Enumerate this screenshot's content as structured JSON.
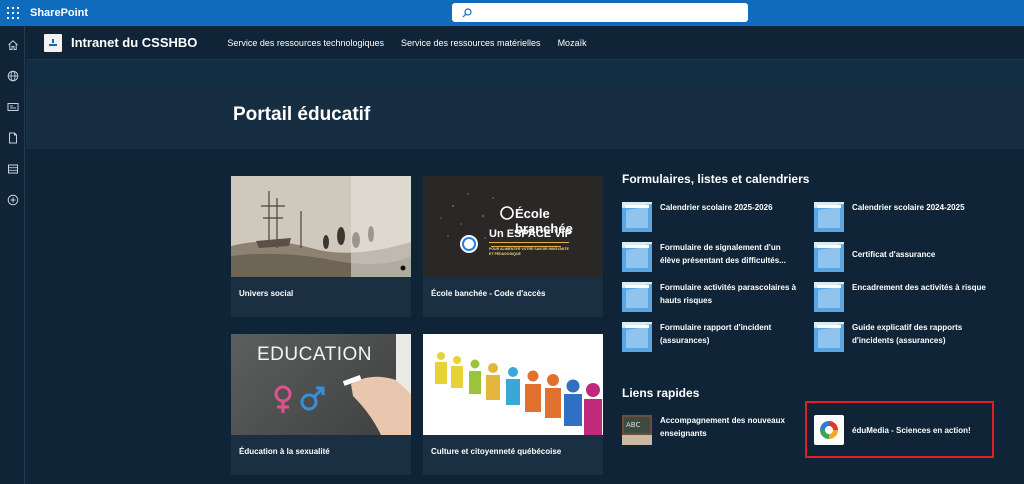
{
  "suitebar": {
    "app_name": "SharePoint",
    "search_placeholder": ""
  },
  "site": {
    "title": "Intranet du CSSHBO",
    "nav": [
      "Service des ressources technologiques",
      "Service des ressources matérielles",
      "Mozaïk"
    ]
  },
  "page": {
    "title": "Portail éducatif"
  },
  "tiles": [
    {
      "label": "Univers social",
      "thumb": "historical-painting"
    },
    {
      "label": "École banchée - Code d'accès",
      "thumb": "ecole-branchee"
    },
    {
      "label": "Éducation à la sexualité",
      "thumb": "education-chalkboard"
    },
    {
      "label": "Culture et citoyenneté québécoise",
      "thumb": "paper-people"
    }
  ],
  "tile_thumb_text": {
    "ecole_title": "École branchée",
    "ecole_vip": "Un ESPACE VIP",
    "ecole_small": "POUR ALIMENTER VOTRE SAVOIR INNOVANTE ET PÉDAGOGIQUE",
    "education": "EDUCATION"
  },
  "forms": {
    "title": "Formulaires, listes et calendriers",
    "items": [
      {
        "label": "Calendrier scolaire 2025-2026"
      },
      {
        "label": "Calendrier scolaire 2024-2025"
      },
      {
        "label": "Formulaire de signalement d'un élève présentant des difficultés..."
      },
      {
        "label": "Certificat d'assurance"
      },
      {
        "label": "Formulaire activités parascolaires à hauts risques"
      },
      {
        "label": "Encadrement des activités à risque"
      },
      {
        "label": "Formulaire rapport d'incident (assurances)"
      },
      {
        "label": "Guide explicatif des rapports d'incidents (assurances)"
      }
    ]
  },
  "quicklinks": {
    "title": "Liens rapides",
    "items": [
      {
        "label": "Accompagnement des nouveaux enseignants",
        "icon": "chalkboard-thumb"
      },
      {
        "label": "éduMedia - Sciences en action!",
        "icon": "edumedia-logo"
      }
    ]
  },
  "colors": {
    "suitebar": "#0f6cbd",
    "background": "#0f2537",
    "title_band": "#172d42",
    "highlight": "#e41d24"
  }
}
